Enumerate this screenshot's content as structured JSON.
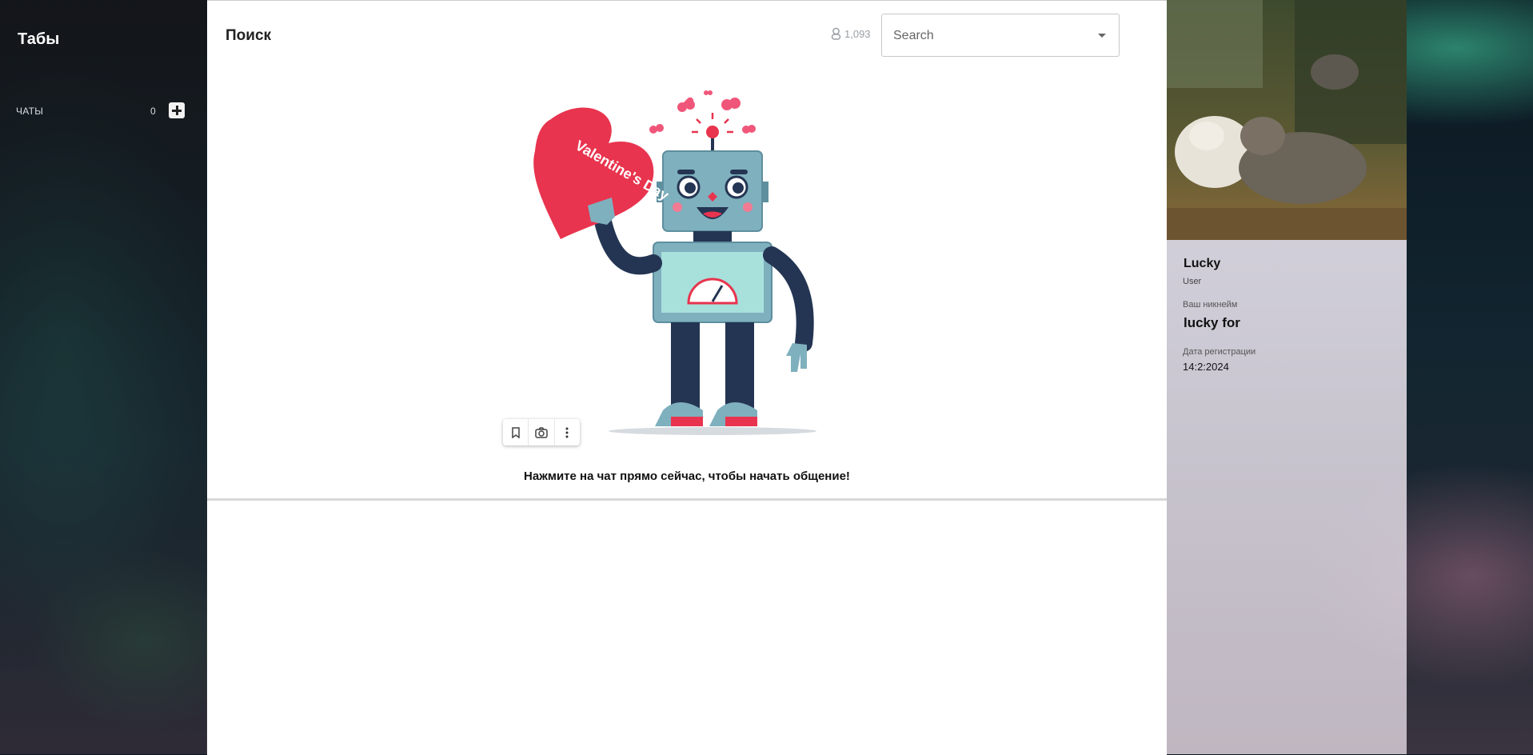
{
  "sidebar": {
    "title": "Табы",
    "chats_label": "ЧАТЫ",
    "chats_count": "0"
  },
  "main": {
    "title": "Поиск",
    "online_count": "1,093",
    "search": {
      "placeholder": "Search"
    },
    "empty_message": "Нажмите на чат прямо сейчас, чтобы начать общение!",
    "illustration_text": "Valentine's Day"
  },
  "profile": {
    "name": "Lucky",
    "role": "User",
    "nickname_label": "Ваш никнейм",
    "nickname": "lucky for",
    "reg_date_label": "Дата регистрации",
    "reg_date": "14:2:2024"
  },
  "icons": [
    "add-chat-icon",
    "user-icon",
    "chevron-down-icon",
    "bookmark-icon",
    "camera-icon",
    "more-vertical-icon"
  ],
  "colors": {
    "accent_heart": "#e8344e",
    "robot_body": "#7fb0be",
    "robot_dark": "#243553"
  }
}
